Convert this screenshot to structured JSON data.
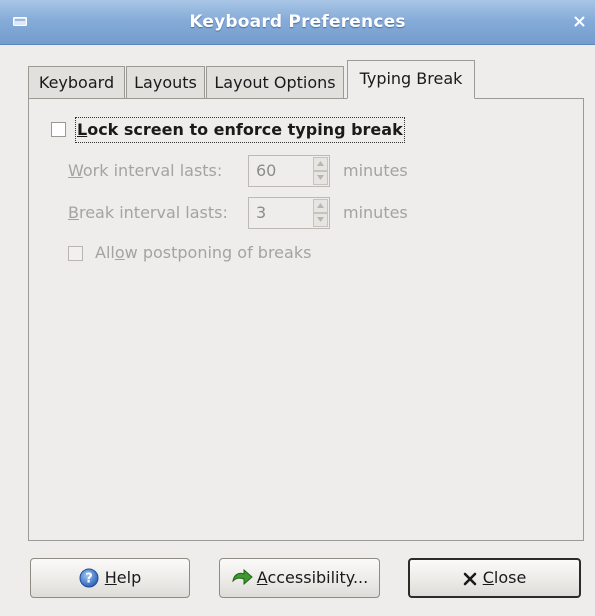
{
  "window": {
    "title": "Keyboard Preferences",
    "menu_icon": "window-menu-icon",
    "close_icon": "close-icon"
  },
  "tabs": [
    {
      "label": "Keyboard",
      "active": false
    },
    {
      "label": "Layouts",
      "active": false
    },
    {
      "label": "Layout Options",
      "active": false
    },
    {
      "label": "Typing Break",
      "active": true
    }
  ],
  "typing_break": {
    "lock_screen": {
      "mnemonic": "L",
      "rest": "ock screen to enforce typing break",
      "checked": false
    },
    "work_interval": {
      "label_mnemonic": "W",
      "label_rest": "ork interval lasts:",
      "value": "60",
      "unit": "minutes",
      "enabled": false
    },
    "break_interval": {
      "label_mnemonic": "B",
      "label_rest": "reak interval lasts:",
      "value": "3",
      "unit": "minutes",
      "enabled": false
    },
    "allow_postpone": {
      "pre": "All",
      "mnemonic": "o",
      "post": "w postponing of breaks",
      "checked": false,
      "enabled": false
    }
  },
  "buttons": {
    "help": {
      "mnemonic": "H",
      "rest": "elp",
      "icon": "help-icon"
    },
    "accessibility": {
      "mnemonic": "A",
      "rest": "ccessibility...",
      "icon": "accessibility-arrow-icon"
    },
    "close": {
      "mnemonic": "C",
      "rest": "lose",
      "icon": "close-x-icon"
    }
  },
  "colors": {
    "titlebar": "#86acd8",
    "background": "#eeedeb",
    "disabled_text": "#a5a39f"
  }
}
